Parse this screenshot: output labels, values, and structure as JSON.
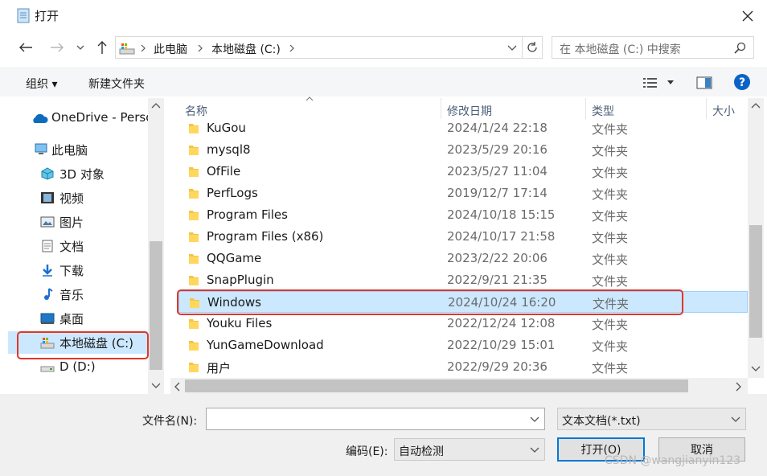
{
  "window": {
    "title": "打开",
    "close_icon": "close-icon"
  },
  "address": {
    "breadcrumbs": [
      "此电脑",
      "本地磁盘 (C:)"
    ],
    "search_placeholder": "在 本地磁盘 (C:) 中搜索"
  },
  "toolbar": {
    "organize_label": "组织 ▾",
    "new_folder_label": "新建文件夹"
  },
  "nav": {
    "items": [
      {
        "label": "OneDrive - Perso",
        "icon": "cloud-icon"
      },
      {
        "label": "此电脑",
        "icon": "computer-icon"
      },
      {
        "label": "3D 对象",
        "icon": "cube-icon"
      },
      {
        "label": "视频",
        "icon": "video-icon"
      },
      {
        "label": "图片",
        "icon": "picture-icon"
      },
      {
        "label": "文档",
        "icon": "document-icon"
      },
      {
        "label": "下载",
        "icon": "download-icon"
      },
      {
        "label": "音乐",
        "icon": "music-icon"
      },
      {
        "label": "桌面",
        "icon": "desktop-icon"
      },
      {
        "label": "本地磁盘 (C:)",
        "icon": "drive-c-icon",
        "selected": true
      },
      {
        "label": "D (D:)",
        "icon": "drive-icon"
      }
    ]
  },
  "columns": {
    "name": "名称",
    "modified": "修改日期",
    "type": "类型",
    "size": "大小"
  },
  "files": [
    {
      "name": "KuGou",
      "modified": "2024/1/24 22:18",
      "type": "文件夹"
    },
    {
      "name": "mysql8",
      "modified": "2023/5/29 20:16",
      "type": "文件夹"
    },
    {
      "name": "OfFile",
      "modified": "2023/5/27 11:04",
      "type": "文件夹"
    },
    {
      "name": "PerfLogs",
      "modified": "2019/12/7 17:14",
      "type": "文件夹"
    },
    {
      "name": "Program Files",
      "modified": "2024/10/18 15:15",
      "type": "文件夹"
    },
    {
      "name": "Program Files (x86)",
      "modified": "2024/10/17 21:58",
      "type": "文件夹"
    },
    {
      "name": "QQGame",
      "modified": "2023/2/22 20:06",
      "type": "文件夹"
    },
    {
      "name": "SnapPlugin",
      "modified": "2022/9/21 21:35",
      "type": "文件夹"
    },
    {
      "name": "Windows",
      "modified": "2024/10/24 16:20",
      "type": "文件夹",
      "selected": true
    },
    {
      "name": "Youku Files",
      "modified": "2022/12/24 12:08",
      "type": "文件夹"
    },
    {
      "name": "YunGameDownload",
      "modified": "2022/10/29 15:01",
      "type": "文件夹"
    },
    {
      "name": "用户",
      "modified": "2022/9/29 20:36",
      "type": "文件夹"
    }
  ],
  "bottom": {
    "filename_label": "文件名(N):",
    "filename_value": "",
    "filetype_value": "文本文档(*.txt)",
    "encoding_label": "编码(E):",
    "encoding_value": "自动检测",
    "open_label": "打开(O)",
    "cancel_label": "取消"
  },
  "watermark": "CSDN @wangjianyin123",
  "colors": {
    "selection": "#cce8ff",
    "highlight_box": "#e0362a",
    "folder": "#f4c542",
    "help": "#0a64c8"
  }
}
